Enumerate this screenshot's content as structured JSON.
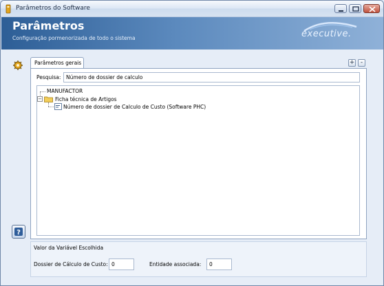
{
  "window": {
    "title": "Parâmetros do Software",
    "controls": {
      "minimize_icon": "minimize-icon",
      "maximize_icon": "maximize-icon",
      "close_icon": "close-icon"
    }
  },
  "banner": {
    "title": "Parâmetros",
    "subtitle": "Configuração pormenorizada de todo o sistema",
    "logo_text": "executive."
  },
  "tab": {
    "label": "Parâmetros gerais"
  },
  "tab_controls": {
    "add": "+",
    "remove": "-"
  },
  "search": {
    "label": "Pesquisa:",
    "value": "Número de dossier de calculo"
  },
  "tree": {
    "root": "MANUFACTOR",
    "folder": "Ficha técnica de Artigos",
    "leaf": "Número de dossier de Calculo de Custo (Software PHC)"
  },
  "variable": {
    "title": "Valor da Variável Escolhida",
    "field1_label": "Dossier de Cálculo de Custo:",
    "field1_value": "0",
    "field2_label": "Entidade associada:",
    "field2_value": "0"
  },
  "colors": {
    "banner": "#2d5e96",
    "window_bg": "#e6edf7",
    "accent": "#5b89bd"
  }
}
